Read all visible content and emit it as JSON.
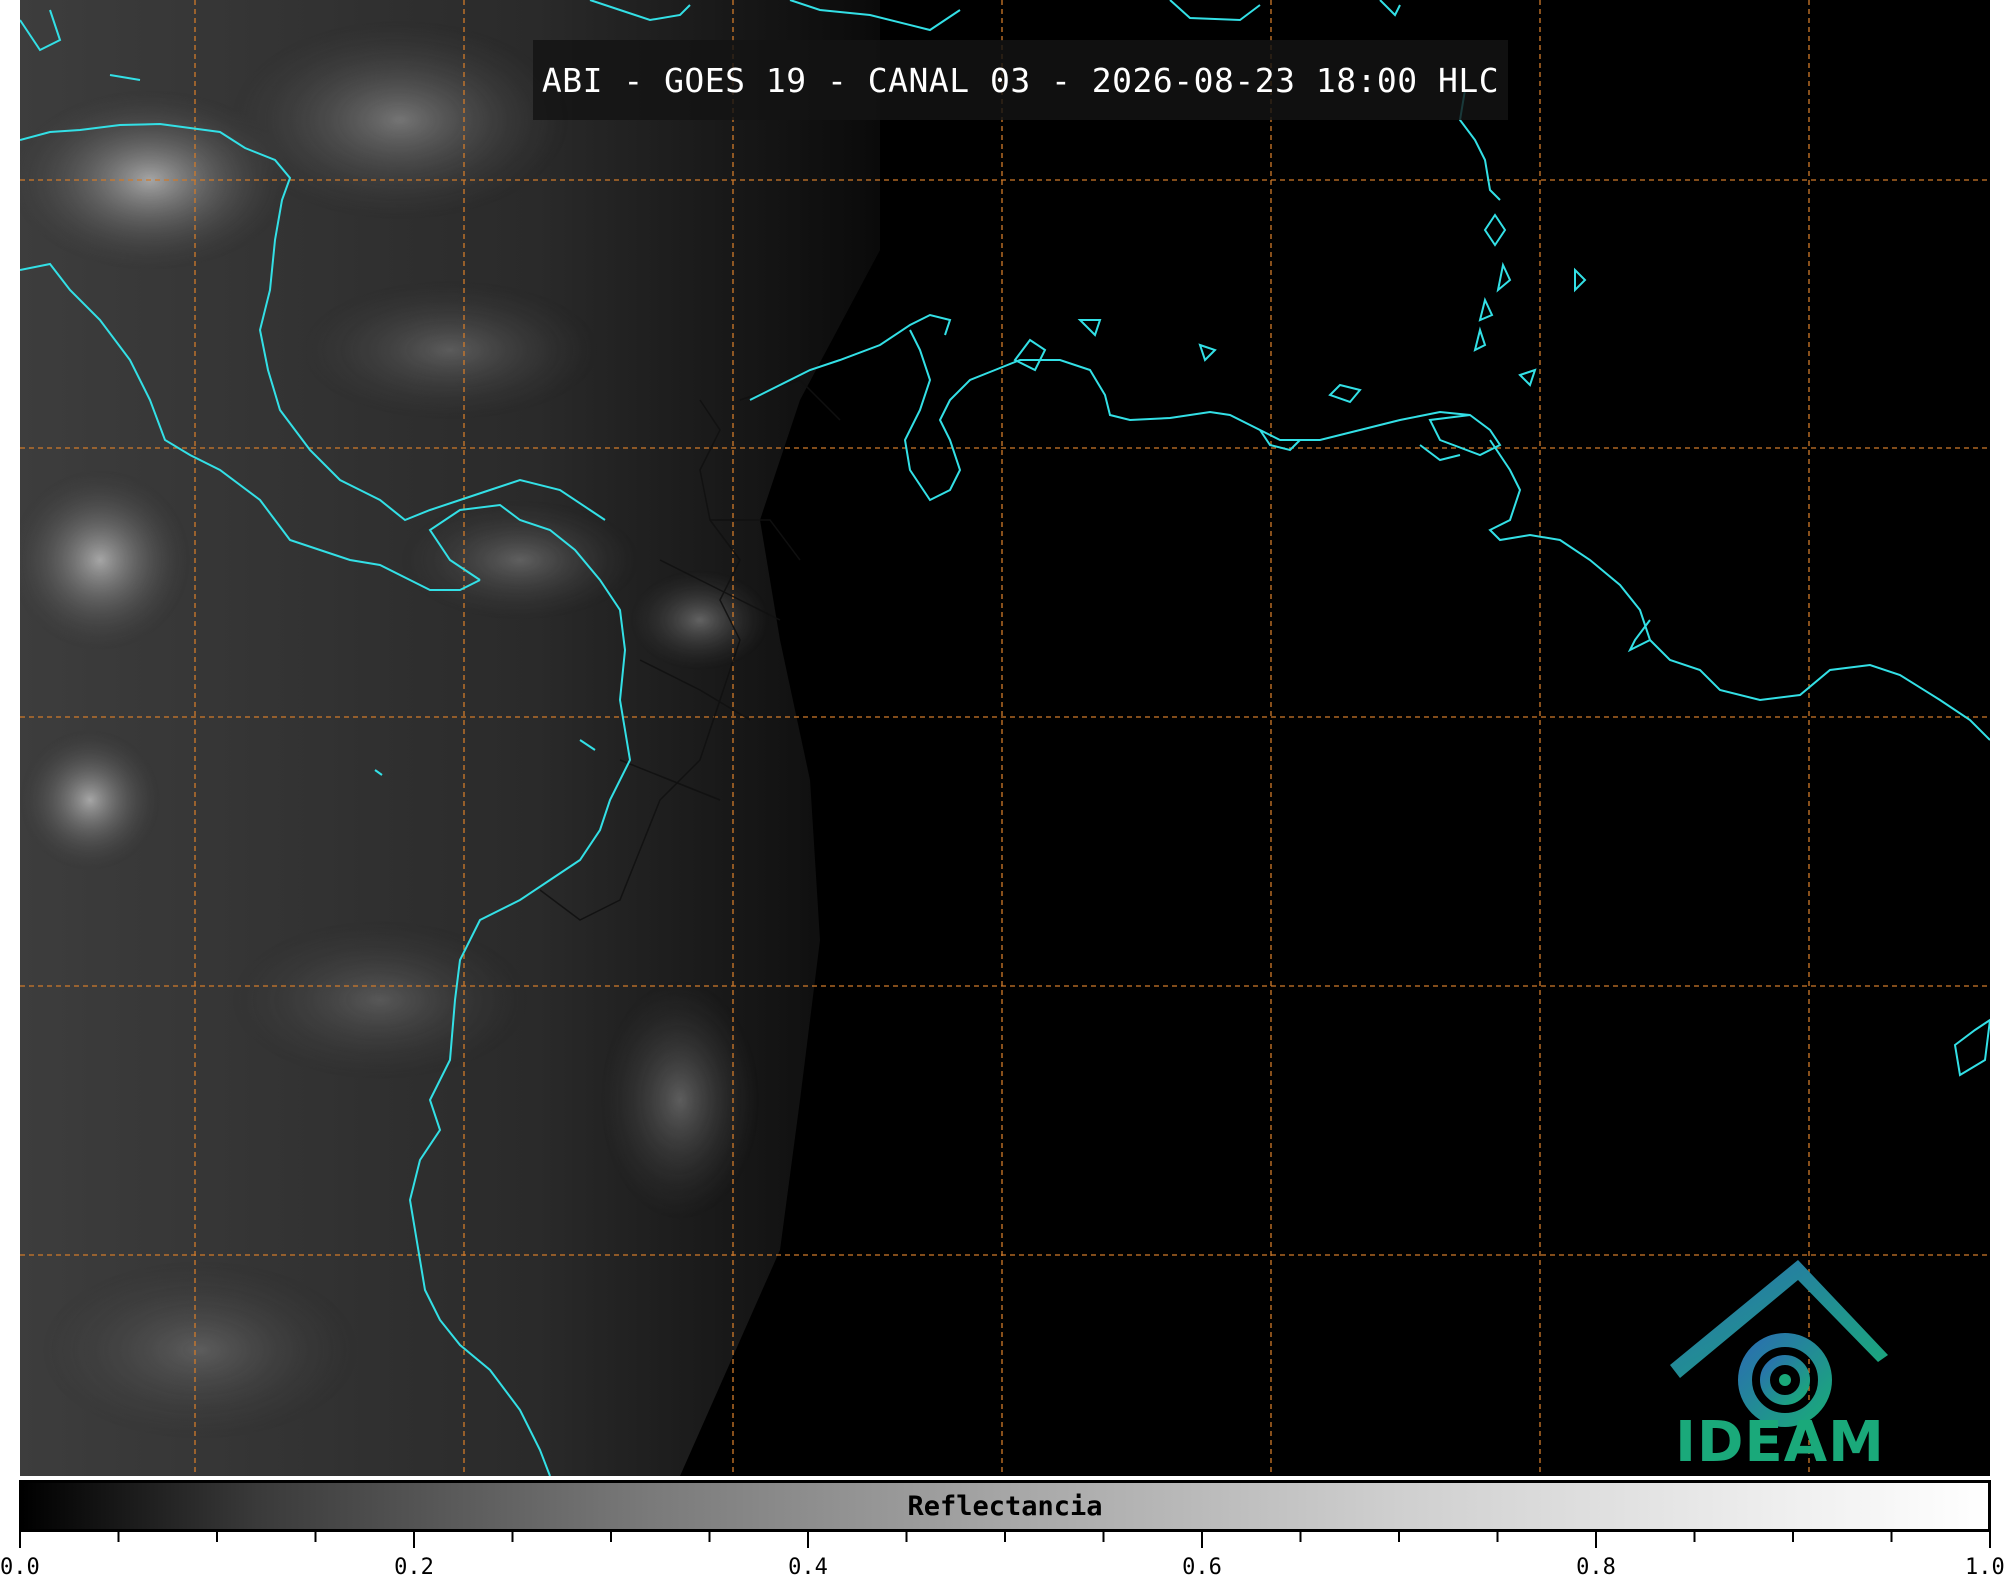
{
  "title": "ABI - GOES 19 - CANAL 03 - 2026-08-23 18:00 HLC",
  "logo": {
    "name": "ideam-logo-icon",
    "text": "IDEAM",
    "color": "#1aa97a"
  },
  "map": {
    "background": "#000000",
    "coastline_color": "#33e0e6",
    "grid_color": "#d07a2a",
    "border_color": "#111111"
  },
  "colorbar": {
    "label": "Reflectancia",
    "range": [
      0.0,
      1.0
    ],
    "cmap": "greys",
    "tick_labels": [
      "0.0",
      "0.2",
      "0.4",
      "0.6",
      "0.8",
      "1.0"
    ]
  }
}
